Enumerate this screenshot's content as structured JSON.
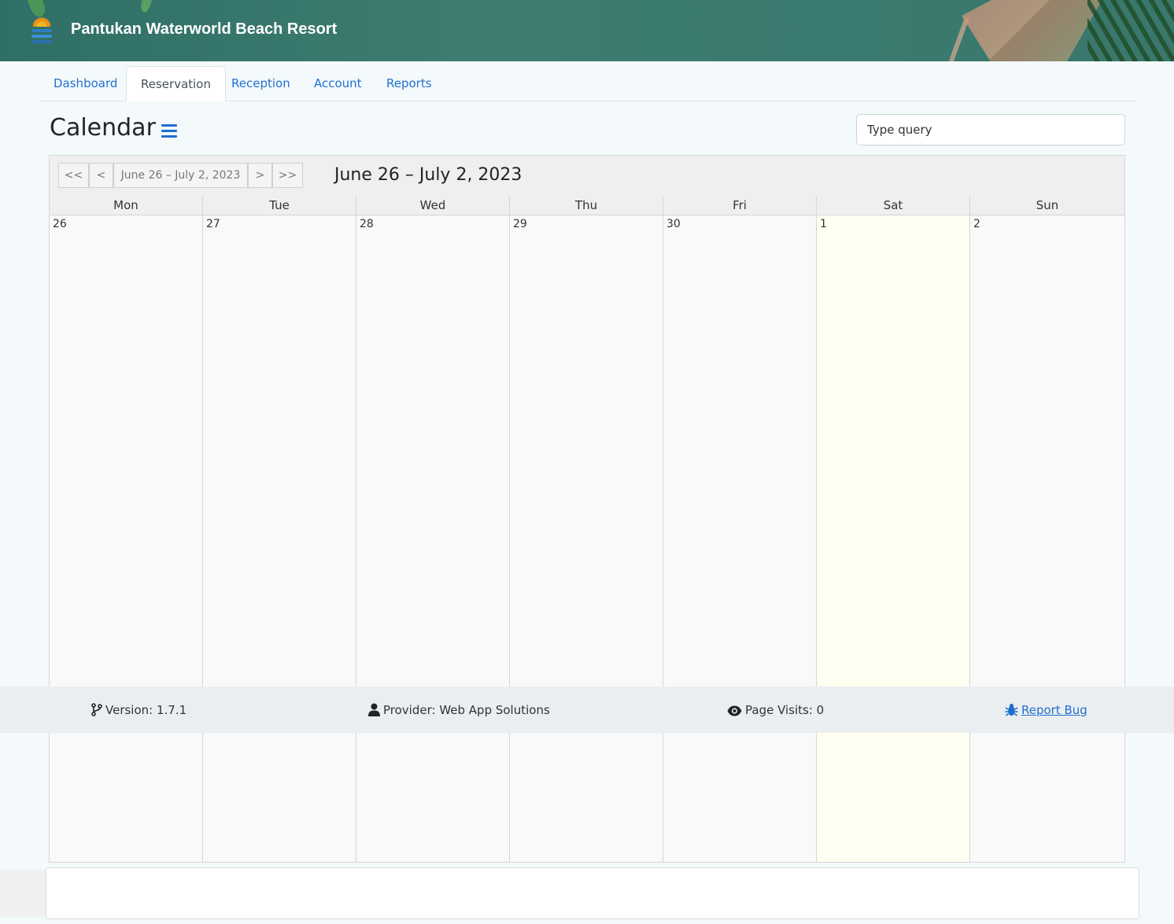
{
  "header": {
    "brand": "Pantukan Waterworld Beach Resort"
  },
  "nav": {
    "tabs": [
      {
        "label": "Dashboard",
        "active": false
      },
      {
        "label": "Reservation",
        "active": true
      },
      {
        "label": "Reception",
        "active": false
      },
      {
        "label": "Account",
        "active": false
      },
      {
        "label": "Reports",
        "active": false
      }
    ]
  },
  "page": {
    "title": "Calendar"
  },
  "search": {
    "placeholder": "Type query"
  },
  "calendar": {
    "buttons": {
      "first": "<<",
      "prev": "<",
      "range": "June 26 – July 2, 2023",
      "next": ">",
      "last": ">>"
    },
    "range_title": "June 26 – July 2, 2023",
    "weekdays": [
      "Mon",
      "Tue",
      "Wed",
      "Thu",
      "Fri",
      "Sat",
      "Sun"
    ],
    "days": [
      "26",
      "27",
      "28",
      "29",
      "30",
      "1",
      "2"
    ],
    "today_color": "#fefff0"
  },
  "footer": {
    "version": "Version: 1.7.1",
    "provider": "Provider: Web App Solutions",
    "visits": "Page Visits: 0",
    "report_bug": "Report Bug"
  }
}
